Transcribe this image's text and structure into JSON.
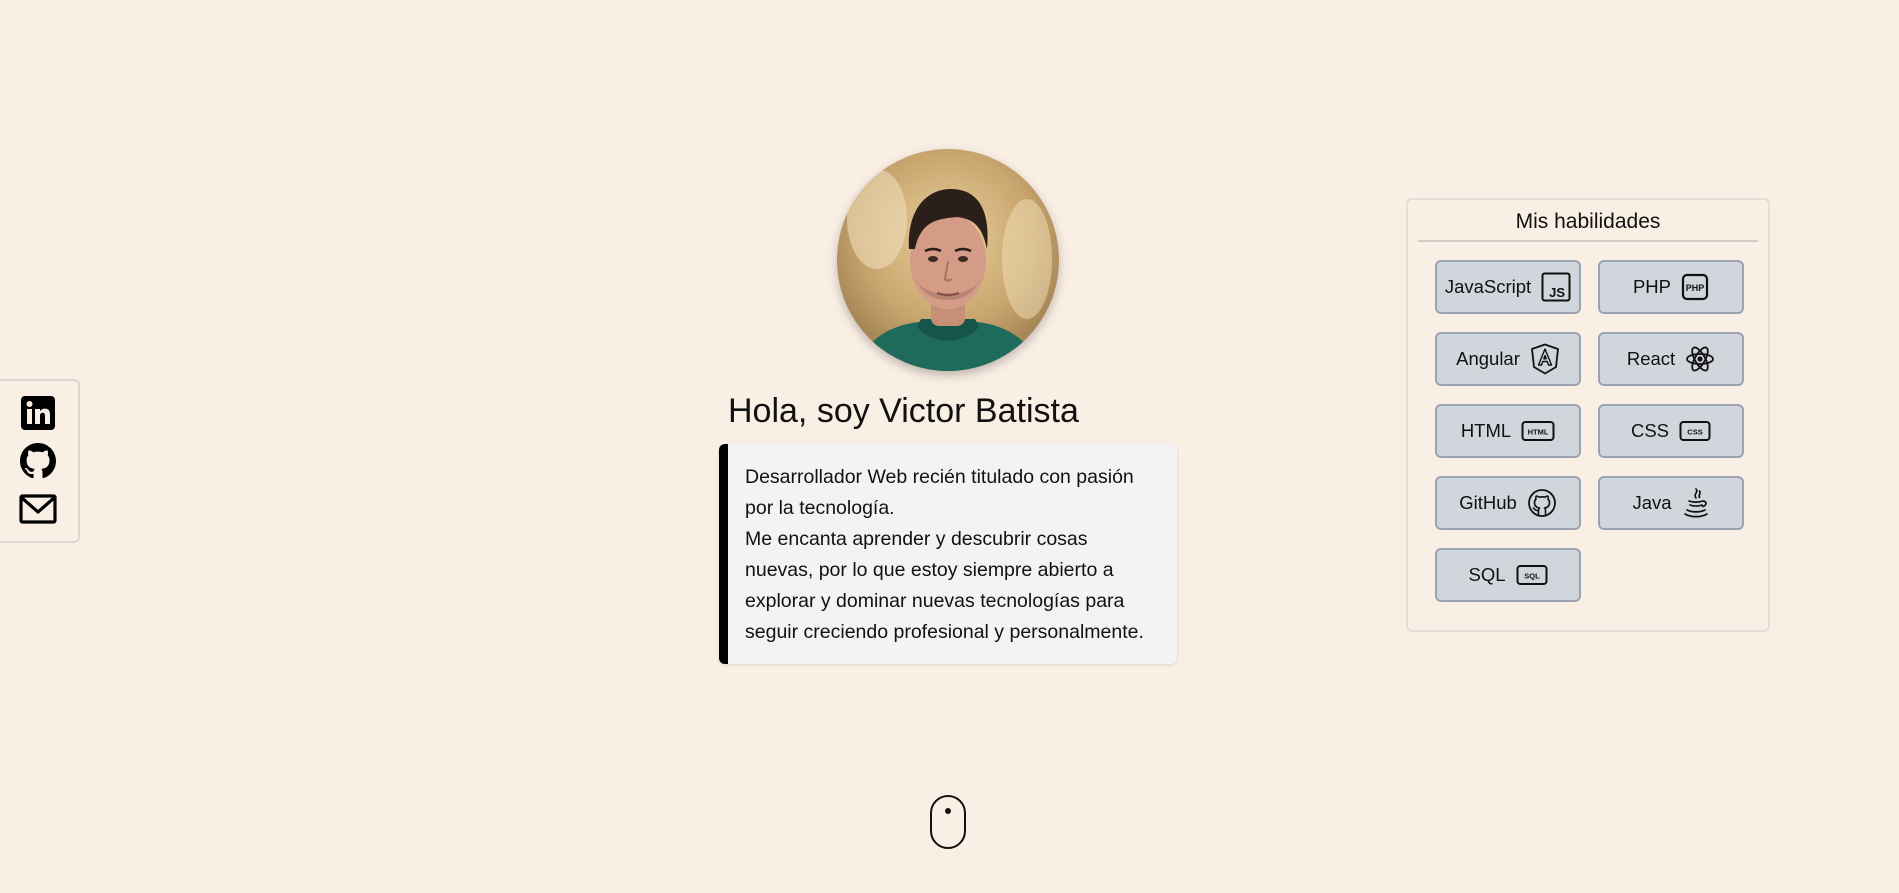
{
  "social": {
    "items": [
      {
        "name": "linkedin",
        "icon": "linkedin-icon"
      },
      {
        "name": "github",
        "icon": "github-icon"
      },
      {
        "name": "email",
        "icon": "mail-icon"
      }
    ]
  },
  "profile": {
    "greeting": "Hola, soy Victor Batista",
    "bio_lines": [
      "Desarrollador Web recién titulado con pasión por la tecnología.",
      "Me encanta aprender y descubrir cosas nuevas, por lo que estoy siempre abierto a explorar y dominar nuevas tecnologías para seguir creciendo profesional y personalmente."
    ]
  },
  "skills": {
    "title": "Mis habilidades",
    "items": [
      {
        "label": "JavaScript",
        "icon": "javascript-icon"
      },
      {
        "label": "PHP",
        "icon": "php-icon"
      },
      {
        "label": "Angular",
        "icon": "angular-icon"
      },
      {
        "label": "React",
        "icon": "react-icon"
      },
      {
        "label": "HTML",
        "icon": "html-icon"
      },
      {
        "label": "CSS",
        "icon": "css-icon"
      },
      {
        "label": "GitHub",
        "icon": "github-icon"
      },
      {
        "label": "Java",
        "icon": "java-icon"
      },
      {
        "label": "SQL",
        "icon": "sql-icon"
      }
    ]
  },
  "colors": {
    "background": "#faefe5",
    "skill_button": "#d1d5dc",
    "bio_accent": "#000000"
  }
}
